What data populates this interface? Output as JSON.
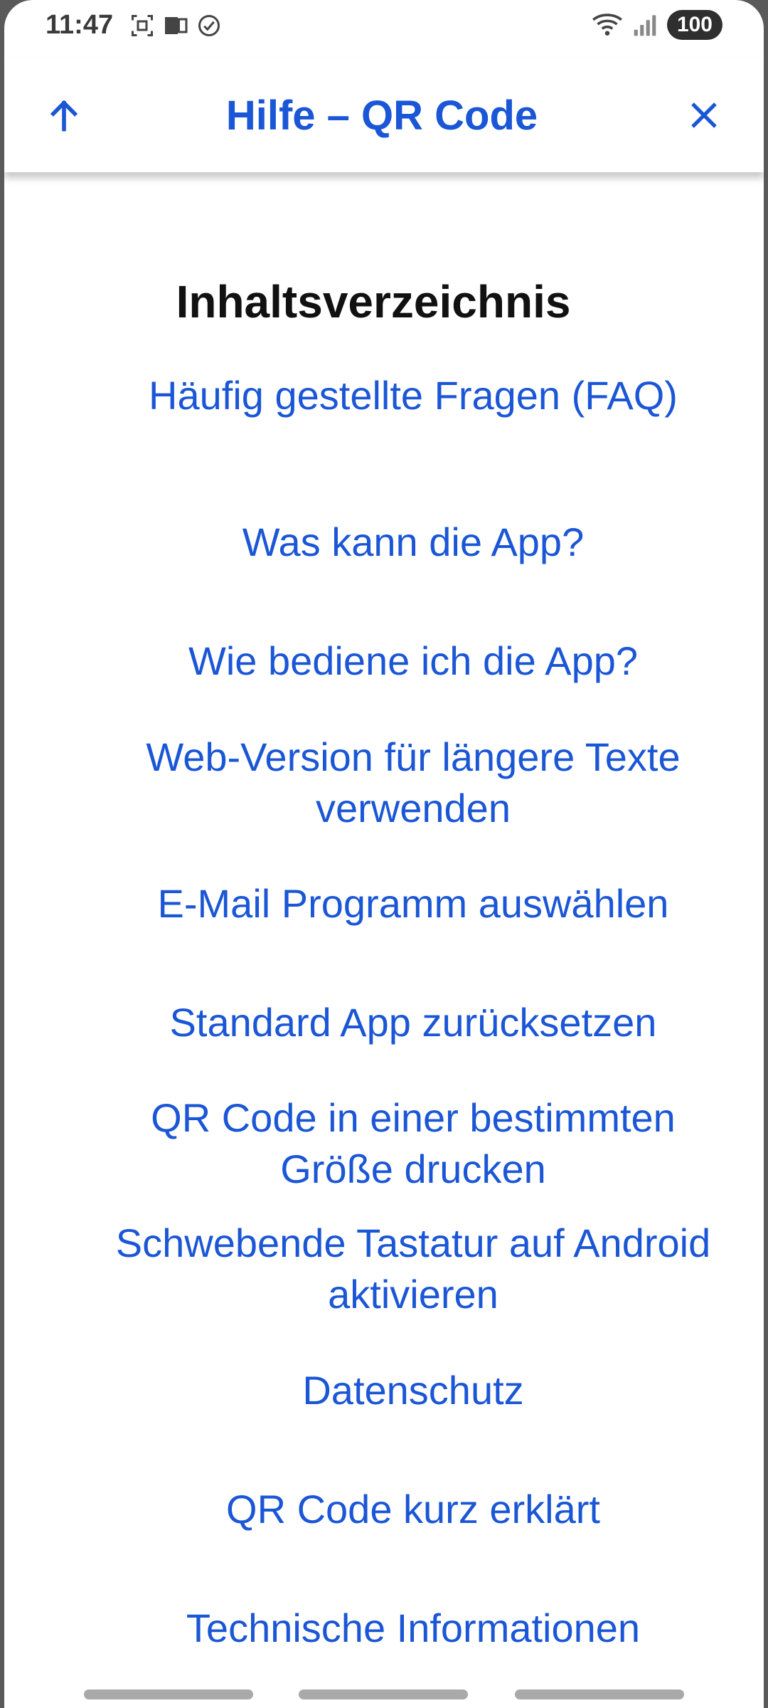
{
  "status_bar": {
    "time": "11:47",
    "battery": "100",
    "icons": [
      "screenshot-icon",
      "device-icon",
      "check-circle-icon",
      "wifi-icon",
      "signal-icon"
    ]
  },
  "toolbar": {
    "title": "Hilfe – QR Code",
    "up_icon": "arrow-up-icon",
    "close_icon": "close-icon",
    "accent": "#1a56d6"
  },
  "toc": {
    "heading": "Inhaltsverzeichnis",
    "items": [
      {
        "label": "Häufig gestellte Fragen (FAQ)"
      },
      {
        "label": "Was kann die App?"
      },
      {
        "label": "Wie bediene ich die App?"
      },
      {
        "label": "Web-Version für längere Texte verwenden"
      },
      {
        "label": "E-Mail Programm auswählen"
      },
      {
        "label": "Standard App zurücksetzen"
      },
      {
        "label": "QR Code in einer bestimmten Größe drucken"
      },
      {
        "label": "Schwebende Tastatur auf Android aktivieren"
      },
      {
        "label": "Datenschutz"
      },
      {
        "label": "QR Code kurz erklärt"
      },
      {
        "label": "Technische Informationen"
      }
    ]
  }
}
